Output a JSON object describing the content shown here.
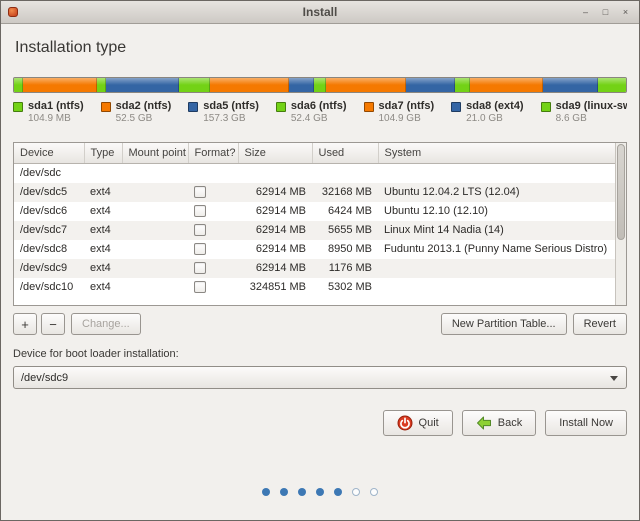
{
  "window": {
    "title": "Install",
    "controls": [
      {
        "name": "minimize",
        "glyph": "–"
      },
      {
        "name": "maximize",
        "glyph": "□"
      },
      {
        "name": "close",
        "glyph": "×"
      }
    ]
  },
  "page": {
    "title": "Installation type"
  },
  "colors": {
    "green": "#73d216",
    "orange": "#f57900",
    "blue": "#3465a4",
    "accent_blue": "#3d78b4"
  },
  "partition_bar": {
    "segments": [
      {
        "color": "green",
        "pct": 1.5
      },
      {
        "color": "orange",
        "pct": 12
      },
      {
        "color": "green",
        "pct": 1.5
      },
      {
        "color": "blue",
        "pct": 12
      },
      {
        "color": "green",
        "pct": 5
      },
      {
        "color": "orange",
        "pct": 13
      },
      {
        "color": "blue",
        "pct": 4
      },
      {
        "color": "green",
        "pct": 2
      },
      {
        "color": "orange",
        "pct": 13
      },
      {
        "color": "blue",
        "pct": 8
      },
      {
        "color": "green",
        "pct": 2.5
      },
      {
        "color": "orange",
        "pct": 12
      },
      {
        "color": "blue",
        "pct": 9
      },
      {
        "color": "green",
        "pct": 4.5
      }
    ]
  },
  "legend": [
    {
      "name": "sda1 (ntfs)",
      "size": "104.9 MB",
      "color": "green"
    },
    {
      "name": "sda2 (ntfs)",
      "size": "52.5 GB",
      "color": "orange"
    },
    {
      "name": "sda5 (ntfs)",
      "size": "157.3 GB",
      "color": "blue"
    },
    {
      "name": "sda6 (ntfs)",
      "size": "52.4 GB",
      "color": "green"
    },
    {
      "name": "sda7 (ntfs)",
      "size": "104.9 GB",
      "color": "orange"
    },
    {
      "name": "sda8 (ext4)",
      "size": "21.0 GB",
      "color": "blue"
    },
    {
      "name": "sda9 (linux-swap)",
      "size": "8.6 GB",
      "color": "green"
    }
  ],
  "table": {
    "columns": [
      "Device",
      "Type",
      "Mount point",
      "Format?",
      "Size",
      "Used",
      "System"
    ],
    "rows": [
      {
        "device": "/dev/sdc",
        "type": "",
        "mount": "",
        "format": null,
        "size": "",
        "used": "",
        "system": ""
      },
      {
        "device": "/dev/sdc5",
        "type": "ext4",
        "mount": "",
        "format": false,
        "size": "62914 MB",
        "used": "32168 MB",
        "system": "Ubuntu 12.04.2 LTS (12.04)"
      },
      {
        "device": "/dev/sdc6",
        "type": "ext4",
        "mount": "",
        "format": false,
        "size": "62914 MB",
        "used": "6424 MB",
        "system": "Ubuntu 12.10 (12.10)"
      },
      {
        "device": "/dev/sdc7",
        "type": "ext4",
        "mount": "",
        "format": false,
        "size": "62914 MB",
        "used": "5655 MB",
        "system": "Linux Mint 14 Nadia (14)"
      },
      {
        "device": "/dev/sdc8",
        "type": "ext4",
        "mount": "",
        "format": false,
        "size": "62914 MB",
        "used": "8950 MB",
        "system": "Fuduntu 2013.1 (Punny Name Serious Distro)"
      },
      {
        "device": "/dev/sdc9",
        "type": "ext4",
        "mount": "",
        "format": false,
        "size": "62914 MB",
        "used": "1176 MB",
        "system": ""
      },
      {
        "device": "/dev/sdc10",
        "type": "ext4",
        "mount": "",
        "format": false,
        "size": "324851 MB",
        "used": "5302 MB",
        "system": ""
      }
    ]
  },
  "partition_actions": {
    "add": "+",
    "remove": "−",
    "change": "Change...",
    "new_table": "New Partition Table...",
    "revert": "Revert"
  },
  "bootloader": {
    "label": "Device for boot loader installation:",
    "value": "/dev/sdc9"
  },
  "footer_buttons": {
    "quit": "Quit",
    "back": "Back",
    "install": "Install Now"
  },
  "progress": {
    "dots": [
      true,
      true,
      true,
      true,
      true,
      false,
      false
    ]
  }
}
